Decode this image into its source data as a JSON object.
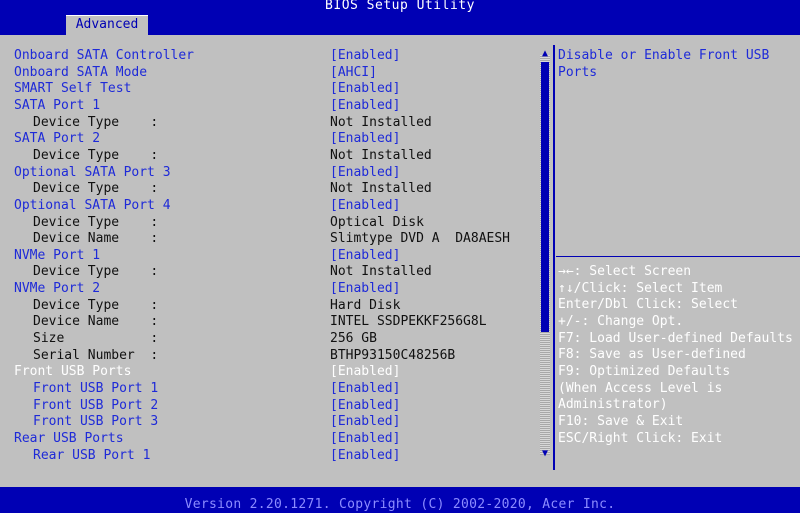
{
  "header": {
    "title": "BIOS Setup Utility",
    "tab_label": "Advanced"
  },
  "settings": [
    {
      "label": "Onboard SATA Controller",
      "value": "[Enabled]",
      "indent": 0,
      "kind": "option"
    },
    {
      "label": "Onboard SATA Mode",
      "value": "[AHCI]",
      "indent": 0,
      "kind": "option"
    },
    {
      "label": "SMART Self Test",
      "value": "[Enabled]",
      "indent": 0,
      "kind": "option"
    },
    {
      "label": "SATA Port 1",
      "value": "[Enabled]",
      "indent": 0,
      "kind": "option"
    },
    {
      "label": "Device Type    :",
      "value": "Not Installed",
      "indent": 1,
      "kind": "info"
    },
    {
      "label": "SATA Port 2",
      "value": "[Enabled]",
      "indent": 0,
      "kind": "option"
    },
    {
      "label": "Device Type    :",
      "value": "Not Installed",
      "indent": 1,
      "kind": "info"
    },
    {
      "label": "Optional SATA Port 3",
      "value": "[Enabled]",
      "indent": 0,
      "kind": "option"
    },
    {
      "label": "Device Type    :",
      "value": "Not Installed",
      "indent": 1,
      "kind": "info"
    },
    {
      "label": "Optional SATA Port 4",
      "value": "[Enabled]",
      "indent": 0,
      "kind": "option"
    },
    {
      "label": "Device Type    :",
      "value": "Optical Disk",
      "indent": 1,
      "kind": "info"
    },
    {
      "label": "Device Name    :",
      "value": "Slimtype DVD A  DA8AESH",
      "indent": 1,
      "kind": "info"
    },
    {
      "label": "NVMe Port 1",
      "value": "[Enabled]",
      "indent": 0,
      "kind": "option"
    },
    {
      "label": "Device Type    :",
      "value": "Not Installed",
      "indent": 1,
      "kind": "info"
    },
    {
      "label": "NVMe Port 2",
      "value": "[Enabled]",
      "indent": 0,
      "kind": "option"
    },
    {
      "label": "Device Type    :",
      "value": "Hard Disk",
      "indent": 1,
      "kind": "info"
    },
    {
      "label": "Device Name    :",
      "value": "INTEL SSDPEKKF256G8L",
      "indent": 1,
      "kind": "info"
    },
    {
      "label": "Size           :",
      "value": "256 GB",
      "indent": 1,
      "kind": "info"
    },
    {
      "label": "Serial Number  :",
      "value": "BTHP93150C48256B",
      "indent": 1,
      "kind": "info"
    },
    {
      "label": "Front USB Ports",
      "value": "[Enabled]",
      "indent": 0,
      "kind": "selected"
    },
    {
      "label": "Front USB Port 1",
      "value": "[Enabled]",
      "indent": 1,
      "kind": "option"
    },
    {
      "label": "Front USB Port 2",
      "value": "[Enabled]",
      "indent": 1,
      "kind": "option"
    },
    {
      "label": "Front USB Port 3",
      "value": "[Enabled]",
      "indent": 1,
      "kind": "option"
    },
    {
      "label": "Rear USB Ports",
      "value": "[Enabled]",
      "indent": 0,
      "kind": "option"
    },
    {
      "label": "Rear USB Port 1",
      "value": "[Enabled]",
      "indent": 1,
      "kind": "option"
    }
  ],
  "help": {
    "description": "Disable or Enable Front USB Ports",
    "keys": [
      "→←: Select Screen",
      "↑↓/Click: Select Item",
      "Enter/Dbl Click: Select",
      "+/-: Change Opt.",
      "F7: Load User-defined Defaults",
      "F8: Save as User-defined",
      "F9: Optimized Defaults",
      "(When Access Level is",
      "Administrator)",
      "F10: Save & Exit",
      "ESC/Right Click: Exit"
    ]
  },
  "footer": {
    "version_text": "Version 2.20.1271. Copyright (C) 2002-2020, Acer Inc."
  },
  "colors": {
    "background": "#0000b4",
    "panel": "#c0c0c0",
    "option_text": "#1e2ad8",
    "info_text": "#101010",
    "selected_text": "#ffffff"
  }
}
